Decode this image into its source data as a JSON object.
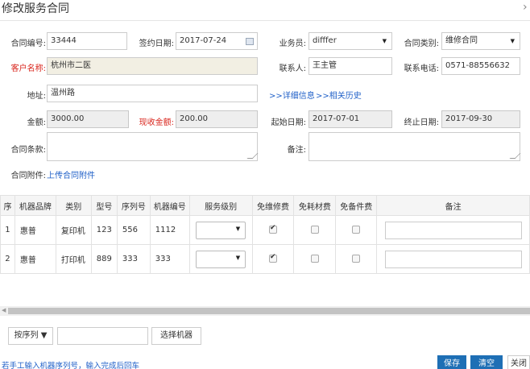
{
  "dialog": {
    "title": "修改服务合同",
    "close_glyph": "›"
  },
  "form": {
    "contract_no": {
      "label": "合同编号:",
      "value": "33444"
    },
    "sign_date": {
      "label": "签约日期:",
      "value": "2017-07-24"
    },
    "salesman": {
      "label": "业务员:",
      "value": "difffer"
    },
    "contract_type": {
      "label": "合同类别:",
      "value": "维修合同"
    },
    "customer_name": {
      "label": "客户名称:",
      "value": "杭州市二医"
    },
    "contact": {
      "label": "联系人:",
      "value": "王主管"
    },
    "phone": {
      "label": "联系电话:",
      "value": "0571-88556632"
    },
    "address": {
      "label": "地址:",
      "value": "温州路"
    },
    "link_detail": ">>详细信息",
    "link_history": ">>相关历史",
    "amount": {
      "label": "金额:",
      "value": "3000.00"
    },
    "received": {
      "label": "现收金额:",
      "value": "200.00"
    },
    "start_date": {
      "label": "起始日期:",
      "value": "2017-07-01"
    },
    "end_date": {
      "label": "终止日期:",
      "value": "2017-09-30"
    },
    "terms": {
      "label": "合同条款:"
    },
    "remarks": {
      "label": "备注:"
    },
    "attachment": {
      "label": "合同附件:",
      "link": "上传合同附件"
    }
  },
  "table": {
    "headers": [
      "序",
      "机器品牌",
      "类别",
      "型号",
      "序列号",
      "机器编号",
      "服务级别",
      "免维修费",
      "免耗材费",
      "免备件费",
      "备注"
    ],
    "rows": [
      {
        "no": "1",
        "brand": "惠普",
        "category": "复印机",
        "model": "123",
        "serial": "556",
        "machine_no": "1112",
        "free_repair": true,
        "free_consumable": false,
        "free_parts": false
      },
      {
        "no": "2",
        "brand": "惠普",
        "category": "打印机",
        "model": "889",
        "serial": "333",
        "machine_no": "333",
        "free_repair": true,
        "free_consumable": false,
        "free_parts": false
      }
    ]
  },
  "bottom": {
    "sort_select": "按序列 ▼",
    "select_machine": "选择机器",
    "hint": "若手工输入机器序列号，输入完成后回车",
    "save": "保存",
    "clear": "清空",
    "close": "关闭"
  }
}
